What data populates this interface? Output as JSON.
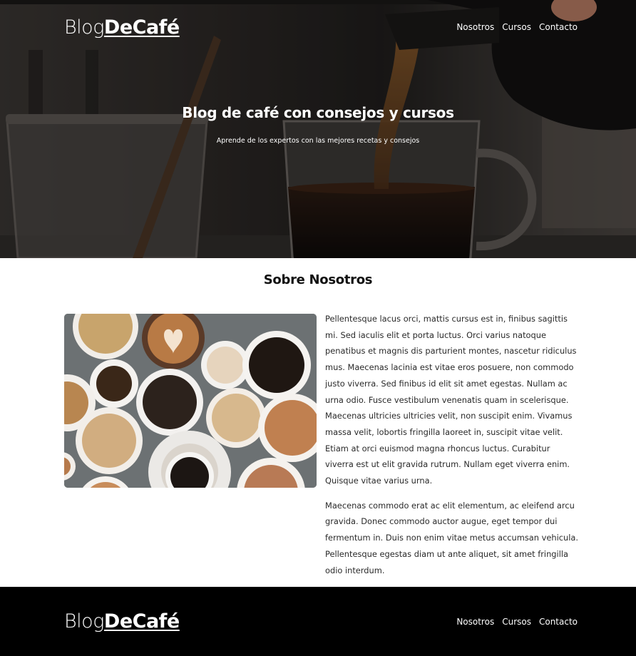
{
  "header": {
    "logo_light": "Blog",
    "logo_bold": "DeCafé",
    "nav": [
      "Nosotros",
      "Cursos",
      "Contacto"
    ]
  },
  "hero": {
    "title": "Blog de café con consejos y cursos",
    "subtitle": "Aprende de los expertos con las mejores recetas y consejos"
  },
  "about": {
    "title": "Sobre Nosotros",
    "paragraphs": [
      "Pellentesque lacus orci, mattis cursus est in, finibus sagittis mi. Sed iaculis elit et porta luctus. Orci varius natoque penatibus et magnis dis parturient montes, nascetur ridiculus mus. Maecenas lacinia est vitae eros posuere, non commodo justo viverra. Sed finibus id elit sit amet egestas. Nullam ac urna odio. Fusce vestibulum venenatis quam in scelerisque. Maecenas ultricies ultricies velit, non suscipit enim. Vivamus massa velit, lobortis fringilla laoreet in, suscipit vitae velit. Etiam at orci euismod magna rhoncus luctus. Curabitur viverra est ut elit gravida rutrum. Nullam eget viverra enim. Quisque vitae varius urna.",
      "Maecenas commodo erat ac elit elementum, ac eleifend arcu gravida. Donec commodo auctor augue, eget tempor dui fermentum in. Duis non enim vitae metus accumsan vehicula. Pellentesque egestas diam ut ante aliquet, sit amet fringilla odio interdum."
    ]
  },
  "footer": {
    "logo_light": "Blog",
    "logo_bold": "DeCafé",
    "nav": [
      "Nosotros",
      "Cursos",
      "Contacto"
    ]
  },
  "colors": {
    "footer_bg": "#000000",
    "hero_text": "#ffffff",
    "body_text": "#2a2a2a"
  }
}
